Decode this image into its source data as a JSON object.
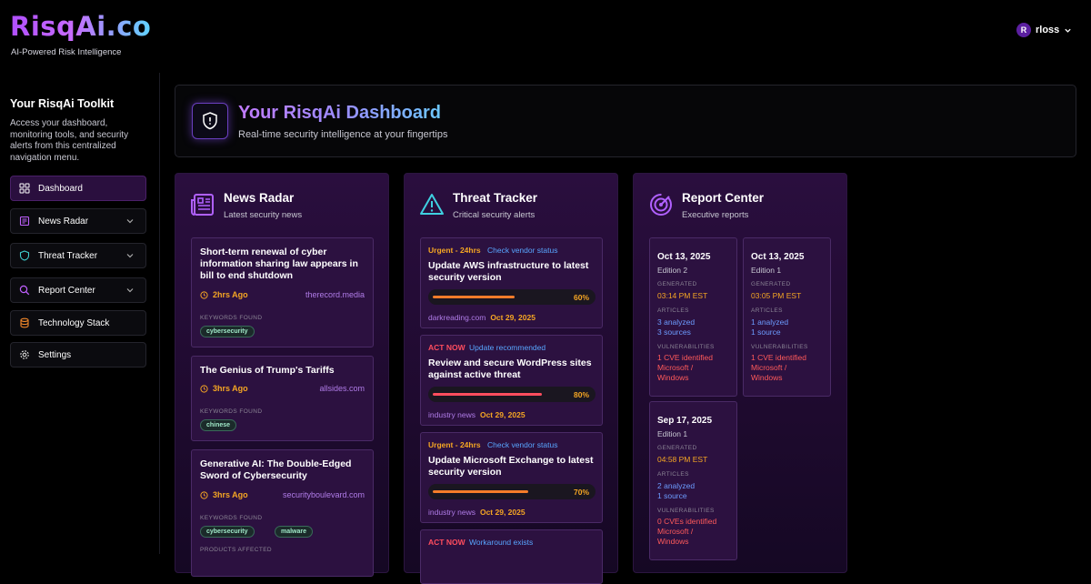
{
  "app": {
    "logo": "RisqAi.co",
    "tagline": "AI-Powered Risk Intelligence",
    "user": {
      "initial": "R",
      "name": "rloss"
    }
  },
  "sidebar": {
    "title": "Your RisqAi Toolkit",
    "description": "Access your dashboard, monitoring tools, and security alerts from this centralized navigation menu.",
    "items": [
      {
        "label": "Dashboard"
      },
      {
        "label": "News Radar"
      },
      {
        "label": "Threat Tracker"
      },
      {
        "label": "Report Center"
      },
      {
        "label": "Technology Stack"
      },
      {
        "label": "Settings"
      }
    ]
  },
  "hero": {
    "title": "Your RisqAi Dashboard",
    "subtitle": "Real-time security intelligence at your fingertips"
  },
  "news": {
    "title": "News Radar",
    "subtitle": "Latest security news",
    "keywords_label": "KEYWORDS FOUND",
    "products_label": "PRODUCTS AFFECTED",
    "items": [
      {
        "title": "Short-term renewal of cyber information sharing law appears in bill to end shutdown",
        "time": "2hrs Ago",
        "source": "therecord.media",
        "tags": [
          "cybersecurity"
        ]
      },
      {
        "title": "The Genius of Trump's Tariffs",
        "time": "3hrs Ago",
        "source": "allsides.com",
        "tags": [
          "chinese"
        ]
      },
      {
        "title": "Generative AI: The Double-Edged Sword of Cybersecurity",
        "time": "3hrs Ago",
        "source": "securityboulevard.com",
        "tags": [
          "cybersecurity",
          "malware"
        ]
      }
    ]
  },
  "threats": {
    "title": "Threat Tracker",
    "subtitle": "Critical security alerts",
    "items": [
      {
        "severity": "Urgent - 24hrs",
        "action": "Check vendor status",
        "title": "Update AWS infrastructure to latest security version",
        "progress": 60,
        "progress_label": "60%",
        "source": "darkreading.com",
        "date": "Oct 29, 2025",
        "color": "#f57c2a"
      },
      {
        "severity": "ACT NOW",
        "action": "Update recommended",
        "title": "Review and secure WordPress sites against active threat",
        "progress": 80,
        "progress_label": "80%",
        "source": "industry news",
        "date": "Oct 29, 2025",
        "color": "#ff4d5e"
      },
      {
        "severity": "Urgent - 24hrs",
        "action": "Check vendor status",
        "title": "Update Microsoft Exchange to latest security version",
        "progress": 70,
        "progress_label": "70%",
        "source": "industry news",
        "date": "Oct 29, 2025",
        "color": "#f57c2a"
      },
      {
        "severity": "ACT NOW",
        "action": "Workaround exists",
        "title": "",
        "progress": 0,
        "progress_label": "",
        "source": "",
        "date": "",
        "color": "#ff4d5e"
      }
    ]
  },
  "reports": {
    "title": "Report Center",
    "subtitle": "Executive reports",
    "generated_label": "GENERATED",
    "articles_label": "ARTICLES",
    "vuln_label": "VULNERABILITIES",
    "items": [
      {
        "date": "Oct 13, 2025",
        "edition": "Edition 2",
        "generated": "03:14 PM EST",
        "analyzed": "3 analyzed",
        "sources": "3 sources",
        "vuln": "1 CVE identified",
        "product1": "Microsoft /",
        "product2": "Windows"
      },
      {
        "date": "Oct 13, 2025",
        "edition": "Edition 1",
        "generated": "03:05 PM EST",
        "analyzed": "1 analyzed",
        "sources": "1 source",
        "vuln": "1 CVE identified",
        "product1": "Microsoft /",
        "product2": "Windows"
      },
      {
        "date": "Sep 17, 2025",
        "edition": "Edition 1",
        "generated": "04:58 PM EST",
        "analyzed": "2 analyzed",
        "sources": "1 source",
        "vuln": "0 CVEs identified",
        "product1": "Microsoft /",
        "product2": "Windows"
      }
    ]
  },
  "colors": {
    "urgent": "#f5a623",
    "act_now": "#ff4d5e",
    "accent": "#b04fff",
    "link": "#58a6ff"
  }
}
